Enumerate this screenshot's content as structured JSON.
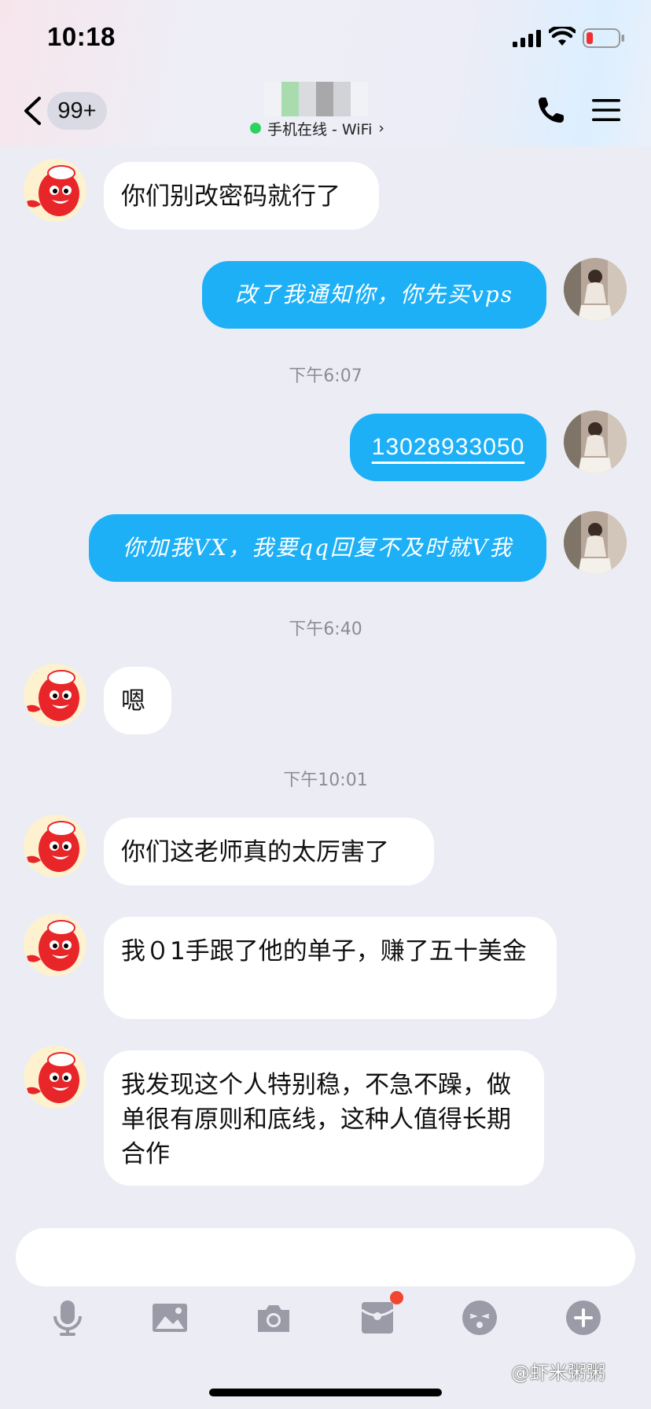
{
  "status_bar": {
    "time": "10:18"
  },
  "header": {
    "unread_count": "99+",
    "online_status": "手机在线 - WiFi",
    "online_chevron": "›"
  },
  "messages": [
    {
      "side": "in",
      "text": "你们别改密码就行了"
    },
    {
      "side": "out",
      "text": "改了我通知你，你先买vps"
    },
    {
      "side": "time",
      "text": "下午6:07"
    },
    {
      "side": "out",
      "text": "13028933050",
      "link": true
    },
    {
      "side": "out",
      "text": "你加我VX，我要qq回复不及时就V我"
    },
    {
      "side": "time",
      "text": "下午6:40"
    },
    {
      "side": "in",
      "text": "嗯"
    },
    {
      "side": "time",
      "text": "下午10:01"
    },
    {
      "side": "in",
      "text": "你们这老师真的太厉害了"
    },
    {
      "side": "in",
      "text": "我０1手跟了他的单子，赚了五十美金"
    },
    {
      "side": "in",
      "text": "我发现这个人特别稳，不急不躁，做单很有原则和底线，这种人值得长期合作"
    }
  ],
  "toolbar": {
    "icons": [
      "microphone-icon",
      "image-icon",
      "camera-icon",
      "red-packet-icon",
      "emoji-icon",
      "plus-icon"
    ],
    "red_packet_has_badge": true
  },
  "watermark": "@虾米粥粥",
  "colors": {
    "out_bubble": "#1db0f7",
    "in_bubble": "#ffffff",
    "background": "#ecedf4",
    "online_dot": "#2ed35f"
  }
}
